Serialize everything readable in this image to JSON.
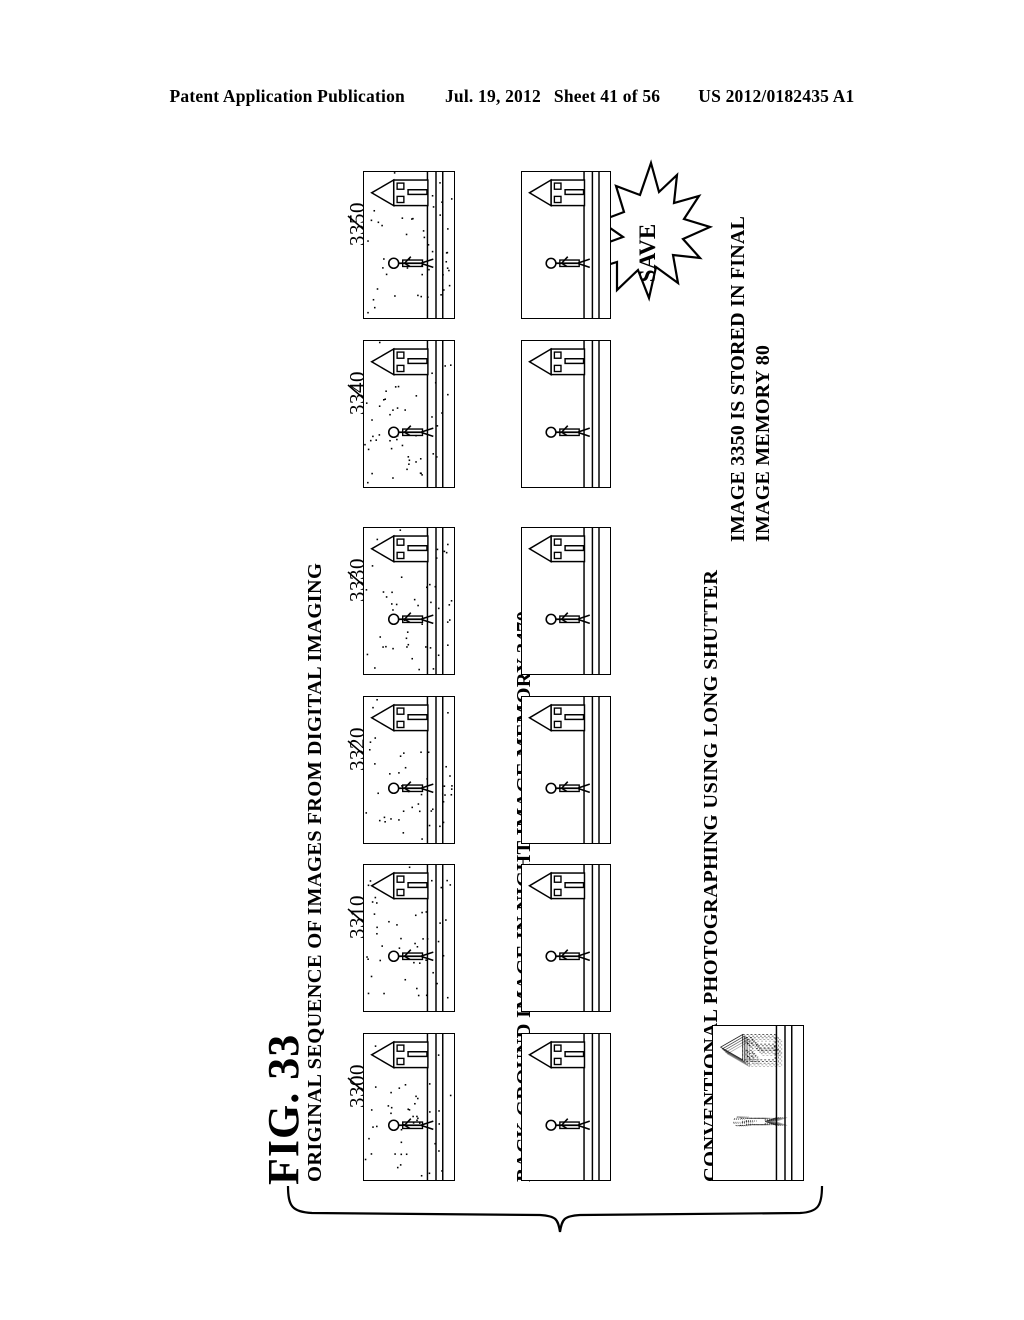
{
  "header": {
    "publication": "Patent Application Publication",
    "date": "Jul. 19, 2012",
    "sheet": "Sheet 41 of 56",
    "document_number": "US 2012/0182435 A1"
  },
  "figure": {
    "label": "FIG. 33",
    "rows": [
      {
        "id": "original-sequence",
        "label": "ORIGINAL SEQUENCE OF IMAGES FROM DIGITAL IMAGING",
        "panels": [
          {
            "ref": "3300",
            "stars": true,
            "house": true,
            "person": true,
            "blurred": false
          },
          {
            "ref": "3310",
            "stars": true,
            "house": true,
            "person": true,
            "blurred": false
          },
          {
            "ref": "3320",
            "stars": true,
            "house": true,
            "person": true,
            "blurred": false
          },
          {
            "ref": "3330",
            "stars": true,
            "house": true,
            "person": true,
            "blurred": false
          },
          {
            "ref": "3340",
            "stars": true,
            "house": true,
            "person": true,
            "blurred": false
          },
          {
            "ref": "3350",
            "stars": true,
            "house": true,
            "person": true,
            "blurred": false
          }
        ]
      },
      {
        "id": "background-image",
        "label": "BACK GROUND IMAGE IN NIGHT IMAGE MEMORY 3470",
        "panels": [
          {
            "ref": "",
            "stars": false,
            "house": true,
            "person": true,
            "blurred": false
          },
          {
            "ref": "",
            "stars": false,
            "house": true,
            "person": true,
            "blurred": false
          },
          {
            "ref": "",
            "stars": false,
            "house": true,
            "person": true,
            "blurred": false
          },
          {
            "ref": "",
            "stars": false,
            "house": true,
            "person": true,
            "blurred": false
          },
          {
            "ref": "",
            "stars": false,
            "house": true,
            "person": true,
            "blurred": false
          },
          {
            "ref": "",
            "stars": false,
            "house": true,
            "person": true,
            "blurred": false
          }
        ]
      },
      {
        "id": "conventional-long-shutter",
        "label": "CONVENTIONAL PHOTOGRAPHING USING LONG SHUTTER",
        "panels": [
          {
            "ref": "",
            "stars": false,
            "house": true,
            "person": true,
            "blurred": true
          }
        ]
      }
    ],
    "save_badge": "SAVE",
    "note": {
      "line1": "IMAGE 3350 IS STORED IN FINAL",
      "line2": "IMAGE MEMORY 80"
    }
  }
}
